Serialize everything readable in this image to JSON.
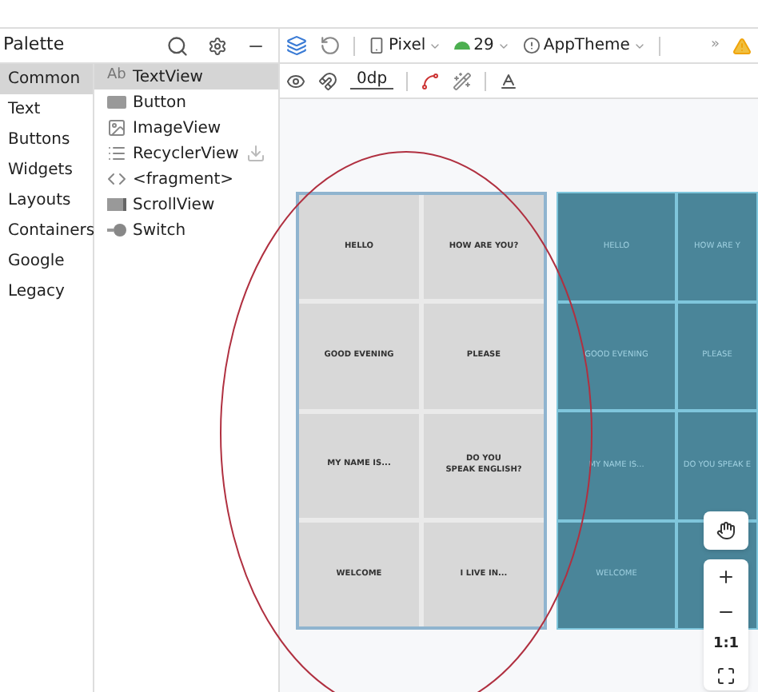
{
  "palette": {
    "title": "Palette",
    "categories": [
      {
        "label": "Common",
        "selected": true
      },
      {
        "label": "Text",
        "selected": false
      },
      {
        "label": "Buttons",
        "selected": false
      },
      {
        "label": "Widgets",
        "selected": false
      },
      {
        "label": "Layouts",
        "selected": false
      },
      {
        "label": "Containers",
        "selected": false
      },
      {
        "label": "Google",
        "selected": false
      },
      {
        "label": "Legacy",
        "selected": false
      }
    ],
    "items": [
      {
        "label": "TextView",
        "kind": "text",
        "selected": true,
        "icon_text": "Ab"
      },
      {
        "label": "Button",
        "kind": "button",
        "selected": false
      },
      {
        "label": "ImageView",
        "kind": "image",
        "selected": false
      },
      {
        "label": "RecyclerView",
        "kind": "list",
        "selected": false,
        "download": true
      },
      {
        "label": "<fragment>",
        "kind": "code",
        "selected": false
      },
      {
        "label": "ScrollView",
        "kind": "scroll",
        "selected": false
      },
      {
        "label": "Switch",
        "kind": "switch",
        "selected": false
      }
    ]
  },
  "toolbar": {
    "device": "Pixel",
    "api": "29",
    "theme": "AppTheme",
    "overflow": "»",
    "margin": "0dp"
  },
  "design_screen": [
    "HELLO",
    "HOW ARE YOU?",
    "GOOD EVENING",
    "PLEASE",
    "MY NAME IS...",
    "DO YOU\nSPEAK ENGLISH?",
    "WELCOME",
    "I LIVE IN..."
  ],
  "blueprint_screen": [
    "HELLO",
    "HOW ARE Y",
    "GOOD EVENING",
    "PLEASE",
    "MY NAME IS...",
    "DO YOU SPEAK E",
    "WELCOME"
  ],
  "zoom_controls": {
    "reset": "1:1"
  }
}
